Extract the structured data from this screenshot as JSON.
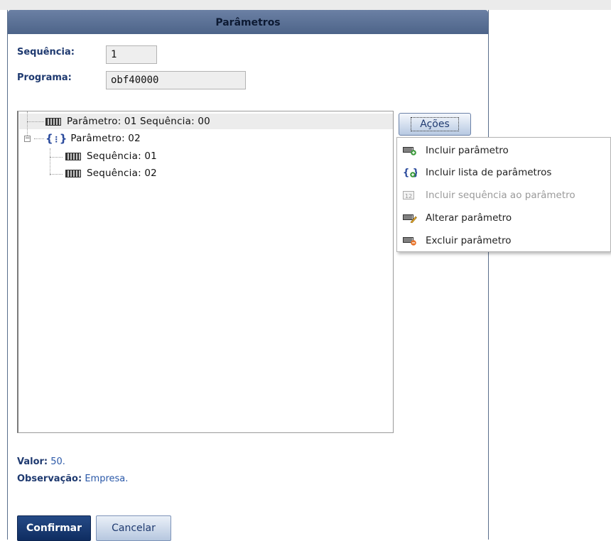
{
  "dialog": {
    "title": "Parâmetros"
  },
  "form": {
    "sequencia_label": "Sequência:",
    "sequencia_value": "1",
    "programa_label": "Programa:",
    "programa_value": "obf40000"
  },
  "tree": {
    "nodes": [
      {
        "label": "Parâmetro: 01 Sequência: 00",
        "icon": "value-icon",
        "selected": true
      },
      {
        "label": "Parâmetro: 02",
        "icon": "braces-icon",
        "expanded": true
      },
      {
        "label": "Sequência: 01",
        "icon": "value-icon"
      },
      {
        "label": "Sequência: 02",
        "icon": "value-icon"
      }
    ]
  },
  "actions": {
    "button_label": "Ações",
    "menu": [
      {
        "label": "Incluir parâmetro",
        "icon": "add-parameter-icon",
        "enabled": true
      },
      {
        "label": "Incluir lista de parâmetros",
        "icon": "add-list-icon",
        "enabled": true
      },
      {
        "label": "Incluir sequência ao parâmetro",
        "icon": "add-sequence-icon",
        "enabled": false
      },
      {
        "label": "Alterar parâmetro",
        "icon": "edit-parameter-icon",
        "enabled": true
      },
      {
        "label": "Excluir parâmetro",
        "icon": "delete-parameter-icon",
        "enabled": true
      }
    ]
  },
  "details": {
    "valor_label": "Valor:",
    "valor_value": "50.",
    "observacao_label": "Observação:",
    "observacao_value": "Empresa."
  },
  "footer": {
    "confirm_label": "Confirmar",
    "cancel_label": "Cancelar"
  },
  "colors": {
    "title_bar": "#5a6f94",
    "label": "#1f3a70",
    "value": "#2a58a8",
    "primary_button": "#163a72"
  }
}
